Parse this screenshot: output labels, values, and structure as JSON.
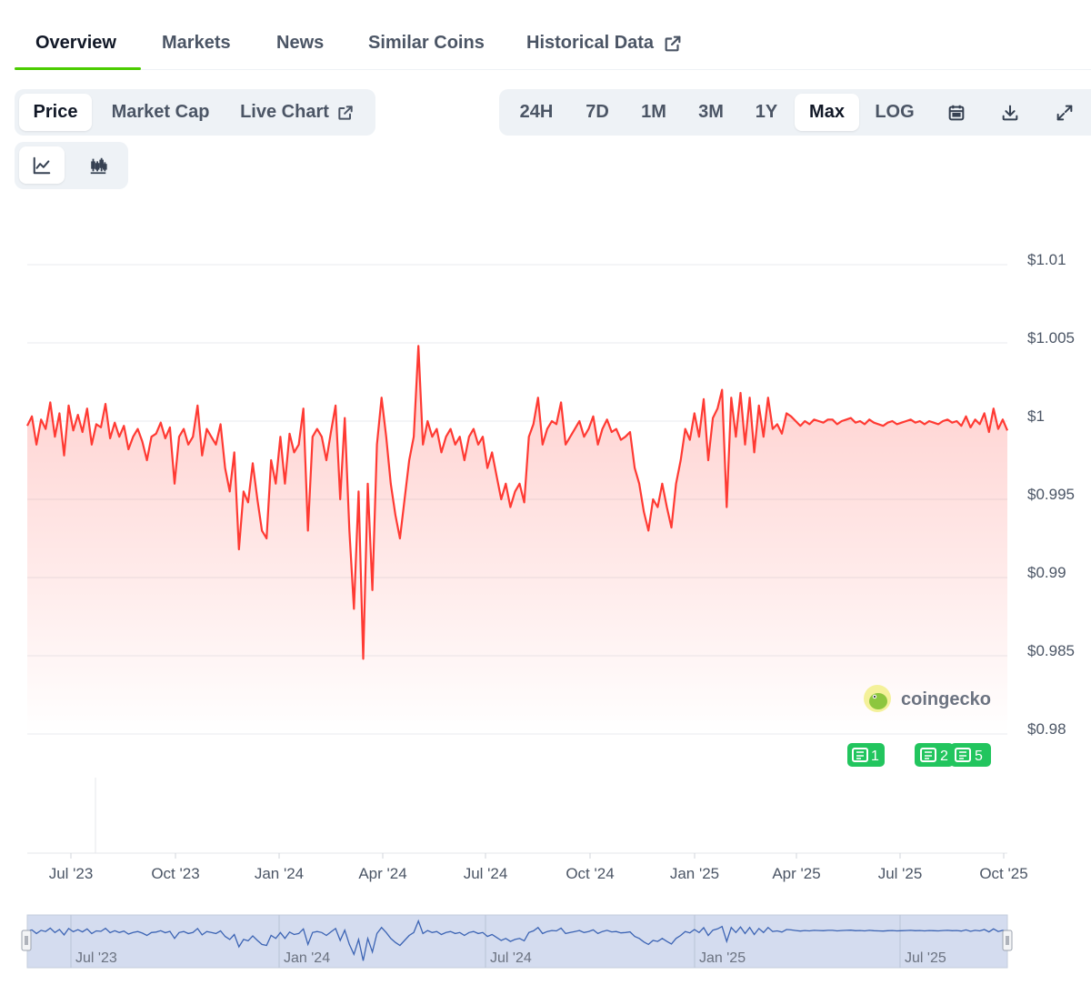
{
  "tabs": [
    {
      "label": "Overview",
      "active": true
    },
    {
      "label": "Markets"
    },
    {
      "label": "News"
    },
    {
      "label": "Similar Coins"
    },
    {
      "label": "Historical Data",
      "icon": "external-link-icon"
    }
  ],
  "data_tabs": [
    {
      "label": "Price",
      "active": true
    },
    {
      "label": "Market Cap"
    },
    {
      "label": "Live Chart",
      "icon": "external-link-icon"
    }
  ],
  "chart_style": [
    {
      "icon": "line-chart-icon",
      "active": true
    },
    {
      "icon": "candlestick-chart-icon"
    }
  ],
  "ranges": [
    {
      "label": "24H"
    },
    {
      "label": "7D"
    },
    {
      "label": "1M"
    },
    {
      "label": "3M"
    },
    {
      "label": "1Y"
    },
    {
      "label": "Max",
      "active": true
    },
    {
      "label": "LOG"
    }
  ],
  "toolbar_icons": [
    "calendar-icon",
    "download-icon",
    "fullscreen-icon"
  ],
  "watermark": "coingecko",
  "news_markers": [
    "1",
    "2",
    "5"
  ],
  "colors": {
    "line": "#ff3a33",
    "accent": "#4bcc00",
    "news": "#22c55e",
    "navigator": "#3c64b4"
  },
  "chart_data": {
    "type": "area",
    "y_ticks": [
      "$1.01",
      "$1.005",
      "$1",
      "$0.995",
      "$0.99",
      "$0.985",
      "$0.98"
    ],
    "ylim": [
      0.98,
      1.01
    ],
    "x_ticks": [
      "Jul '23",
      "Oct '23",
      "Jan '24",
      "Apr '24",
      "Jul '24",
      "Oct '24",
      "Jan '25",
      "Apr '25",
      "Jul '25",
      "Oct '25"
    ],
    "navigator_ticks": [
      "Jul '23",
      "Jan '24",
      "Jul '24",
      "Jan '25",
      "Jul '25"
    ],
    "grid": true,
    "series": [
      {
        "values": [
          0.9997,
          1.0003,
          0.9985,
          1.0001,
          0.9995,
          1.0012,
          0.999,
          1.0005,
          0.9978,
          1.001,
          0.9994,
          1.0004,
          0.9993,
          1.0008,
          0.9985,
          0.9998,
          0.9996,
          1.0011,
          0.9989,
          0.9999,
          0.999,
          0.9997,
          0.9982,
          0.999,
          0.9995,
          0.9987,
          0.9975,
          0.999,
          0.9992,
          0.9999,
          0.9989,
          0.9996,
          0.996,
          0.999,
          0.9995,
          0.9985,
          0.999,
          1.001,
          0.9978,
          0.9995,
          0.999,
          0.9985,
          0.9998,
          0.997,
          0.9955,
          0.998,
          0.9918,
          0.9955,
          0.9948,
          0.9973,
          0.995,
          0.993,
          0.9925,
          0.9975,
          0.996,
          0.999,
          0.996,
          0.9992,
          0.998,
          0.9985,
          1.0008,
          0.993,
          0.999,
          0.9995,
          0.999,
          0.9975,
          0.9993,
          1.001,
          0.995,
          1.0002,
          0.993,
          0.988,
          0.9955,
          0.9848,
          0.996,
          0.9892,
          0.9985,
          1.0015,
          0.999,
          0.996,
          0.994,
          0.9925,
          0.995,
          0.9975,
          0.999,
          1.0048,
          0.9985,
          1.0,
          0.999,
          0.9995,
          0.998,
          0.999,
          0.9995,
          0.9985,
          0.999,
          0.9975,
          0.999,
          0.9995,
          0.9985,
          0.999,
          0.997,
          0.998,
          0.9965,
          0.995,
          0.996,
          0.9945,
          0.9955,
          0.996,
          0.9948,
          0.999,
          0.9998,
          1.0015,
          0.9985,
          0.9995,
          1.0,
          0.9998,
          1.0012,
          0.9985,
          0.999,
          0.9995,
          1.0,
          0.999,
          0.9995,
          1.0003,
          0.9985,
          0.9995,
          1.0001,
          0.9993,
          0.9995,
          0.9988,
          0.999,
          0.9993,
          0.997,
          0.996,
          0.9942,
          0.993,
          0.995,
          0.9945,
          0.996,
          0.9945,
          0.9932,
          0.996,
          0.9975,
          0.9995,
          0.9988,
          1.0005,
          0.999,
          1.0014,
          0.9975,
          1.0002,
          1.0008,
          1.002,
          0.9945,
          1.0015,
          0.999,
          1.0018,
          0.9985,
          1.0015,
          0.998,
          1.001,
          0.999,
          1.0015,
          0.9995,
          0.9998,
          0.9992,
          1.0005,
          1.0003,
          1.0,
          0.9997,
          1.0,
          0.9998,
          1.0001,
          1.0,
          0.9999,
          1.0001,
          1.0001,
          0.9998,
          1.0,
          1.0001,
          1.0002,
          0.9999,
          1.0,
          0.9998,
          1.0001,
          0.9999,
          0.9998,
          0.9997,
          0.9999,
          1.0,
          0.9998,
          0.9999,
          1.0,
          1.0001,
          0.9999,
          1.0,
          0.9998,
          1.0,
          0.9999,
          0.9998,
          1.0,
          1.0001,
          0.9999,
          1.0,
          0.9997,
          1.0003,
          0.9996,
          1.0001,
          0.9998,
          1.0005,
          0.9993,
          1.0008,
          0.9995,
          1.0001,
          0.9994
        ]
      }
    ]
  }
}
